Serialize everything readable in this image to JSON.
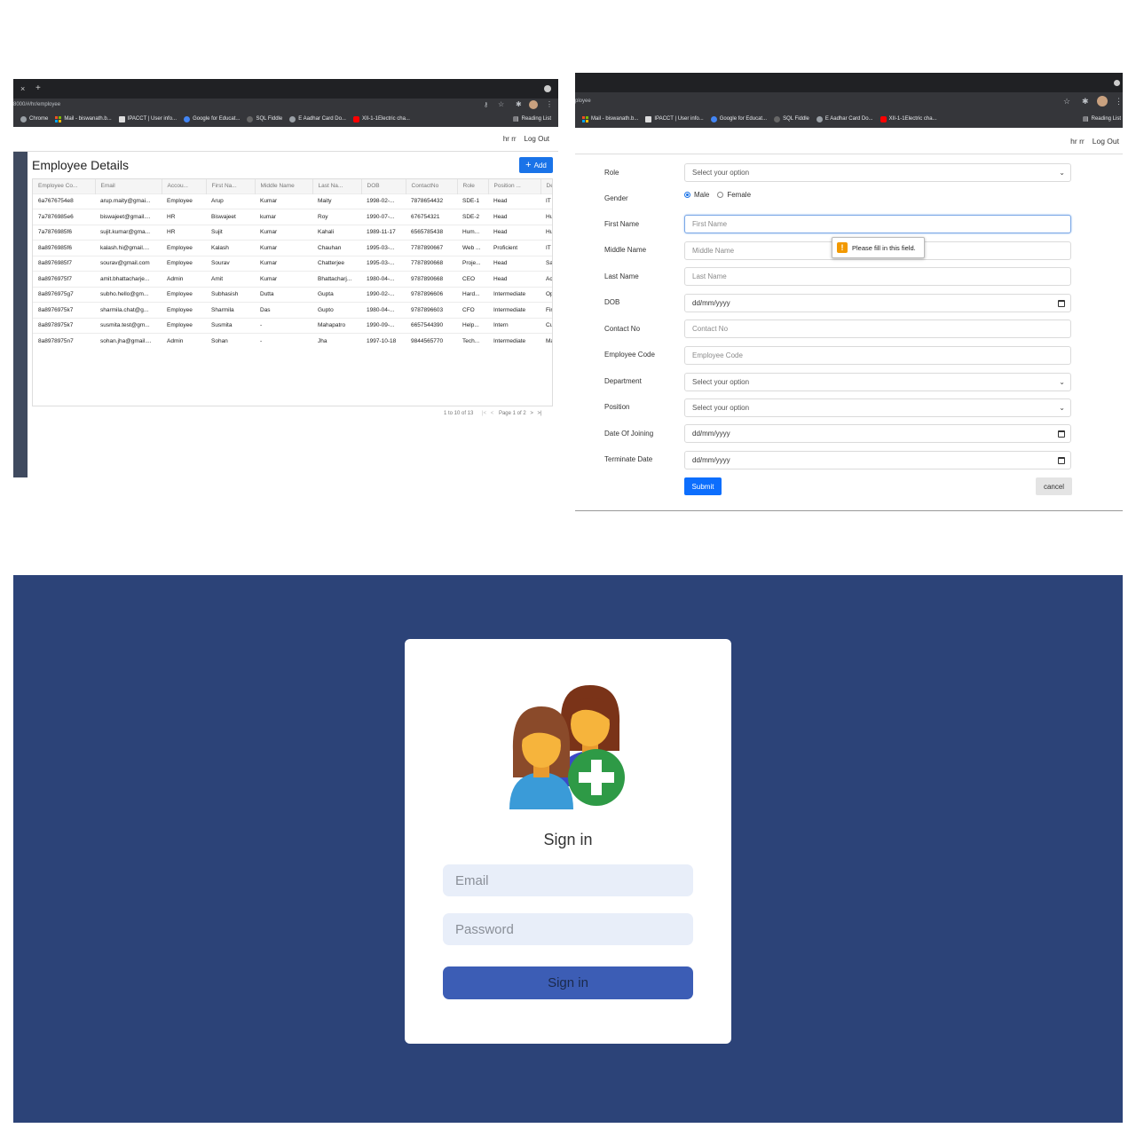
{
  "panel1": {
    "url": "8000/#/hr/employee",
    "tab_close": "×",
    "tab_new": "+",
    "bookmarks": [
      "Chrome",
      "Mail - biswanath.b...",
      "IPACCT | User info...",
      "Google for Educat...",
      "SQL Fiddle",
      "E Aadhar Card Do...",
      "XII-1-1Electric cha..."
    ],
    "reading_list": "Reading List",
    "user": "hr rr",
    "logout": "Log Out",
    "title": "Employee Details",
    "add_label": "Add",
    "columns": [
      "Employee Co...",
      "Email",
      "Accou...",
      "First Na...",
      "Middle Name",
      "Last Na...",
      "DOB",
      "ContactNo",
      "Role",
      "Position ...",
      "De"
    ],
    "rows": [
      [
        "6a7676754e8",
        "arup.maity@gmai...",
        "Employee",
        "Arup",
        "Kumar",
        "Maity",
        "1998-02-...",
        "7878654432",
        "SDE-1",
        "Head",
        "IT"
      ],
      [
        "7a7876985e6",
        "biswajeet@gmail....",
        "HR",
        "Biswajeet",
        "kumar",
        "Roy",
        "1990-07-...",
        "676754321",
        "SDE-2",
        "Head",
        "Hu"
      ],
      [
        "7a7876985f6",
        "sujit.kumar@gma...",
        "HR",
        "Sujit",
        "Kumar",
        "Kahali",
        "1989-11-17",
        "6565785438",
        "Hum...",
        "Head",
        "Hu"
      ],
      [
        "8a8976985f6",
        "kalash.hi@gmail....",
        "Employee",
        "Kalash",
        "Kumar",
        "Chauhan",
        "1995-03-...",
        "7787890667",
        "Web ...",
        "Proficient",
        "IT"
      ],
      [
        "8a8976985f7",
        "sourav@gmail.com",
        "Employee",
        "Sourav",
        "Kumar",
        "Chatterjee",
        "1995-03-...",
        "7787890668",
        "Proje...",
        "Head",
        "Sa"
      ],
      [
        "8a8976975f7",
        "amit.bhattacharje...",
        "Admin",
        "Amit",
        "Kumar",
        "Bhattacharj...",
        "1980-04-...",
        "9787890668",
        "CEO",
        "Head",
        "Ac"
      ],
      [
        "8a8976975g7",
        "subho.hello@gm...",
        "Employee",
        "Subhasish",
        "Dutta",
        "Gupta",
        "1990-02-...",
        "9787896606",
        "Hard...",
        "Intermediate",
        "Op"
      ],
      [
        "8a8976975k7",
        "sharmila.chat@g...",
        "Employee",
        "Sharmila",
        "Das",
        "Gupto",
        "1980-04-...",
        "9787896603",
        "CFO",
        "Intermediate",
        "Fir"
      ],
      [
        "8a8978975k7",
        "susmita.test@gm...",
        "Employee",
        "Susmita",
        "-",
        "Mahapatro",
        "1990-09-...",
        "6657544390",
        "Help...",
        "Intern",
        "Cu"
      ],
      [
        "8a8978975n7",
        "sohan.jha@gmail....",
        "Admin",
        "Sohan",
        "-",
        "Jha",
        "1997-10-18",
        "9844565770",
        "Tech...",
        "Intermediate",
        "Ma"
      ]
    ],
    "pager_range": "1 to 10 of 13",
    "pager_first": "|<",
    "pager_prev": "<",
    "pager_page": "Page 1 of 2",
    "pager_next": ">",
    "pager_last": ">|"
  },
  "panel2": {
    "url_fragment": "ployee",
    "bookmarks": [
      "Mail - biswanath.b...",
      "IPACCT | User info...",
      "Google for Educat...",
      "SQL Fiddle",
      "E Aadhar Card Do...",
      "XII-1-1Electric cha..."
    ],
    "reading_list": "Reading List",
    "user": "hr rr",
    "logout": "Log Out",
    "labels": {
      "role": "Role",
      "gender": "Gender",
      "first_name": "First Name",
      "middle_name": "Middle Name",
      "last_name": "Last Name",
      "dob": "DOB",
      "contact": "Contact No",
      "emp_code": "Employee Code",
      "department": "Department",
      "position": "Position",
      "doj": "Date Of Joining",
      "terminate": "Terminate Date"
    },
    "select_placeholder": "Select your option",
    "gender_male": "Male",
    "gender_female": "Female",
    "gender_selected": "Male",
    "placeholders": {
      "first_name": "First Name",
      "middle_name": "Middle Name",
      "last_name": "Last Name",
      "contact": "Contact No",
      "emp_code": "Employee Code"
    },
    "date_placeholder": "dd/mm/yyyy",
    "tooltip_text": "Please fill in this field.",
    "tooltip_icon": "!",
    "submit_label": "Submit",
    "cancel_label": "cancel"
  },
  "panel3": {
    "title": "Sign in",
    "email_placeholder": "Email",
    "password_placeholder": "Password",
    "button_label": "Sign in"
  },
  "icons": {
    "add": "plus-icon",
    "select": "chevron-down-icon",
    "date": "calendar-icon",
    "warning": "warning-icon",
    "logo": "two-users-add-icon"
  },
  "colors": {
    "accent_blue": "#1a73e8",
    "submit_blue": "#0d6efd",
    "signin_bg": "#2c4378",
    "signin_button": "#3c5db5",
    "input_bg": "#e8eef9",
    "sidebar": "#3f4a5f",
    "warning": "#f29900",
    "logo_plus": "#2e9a46"
  }
}
